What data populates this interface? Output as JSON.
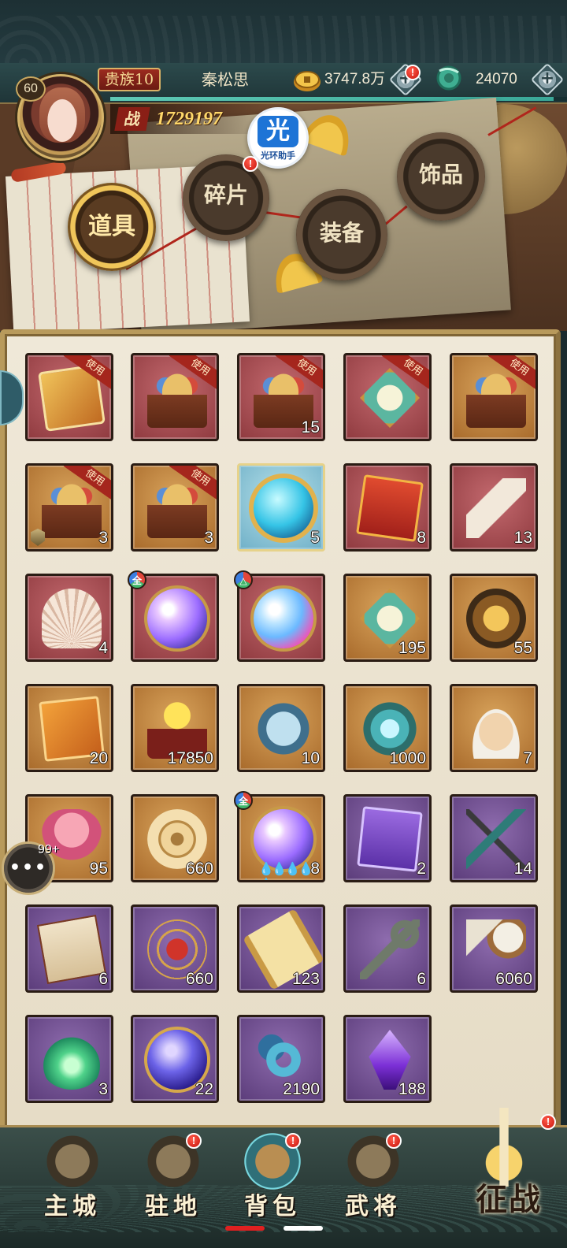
{
  "header": {
    "level": "60",
    "vip": "贵族10",
    "player_name": "秦松思",
    "gold": "3747.8万",
    "jade": "24070",
    "xp_fraction": 0.97,
    "power_icon": "战",
    "power_value": "1729197",
    "helper_icon": "光",
    "helper_label": "光环助手"
  },
  "tabs": [
    {
      "label": "道具",
      "active": true
    },
    {
      "label": "碎片",
      "badge": "!"
    },
    {
      "label": "装备"
    },
    {
      "label": "饰品"
    }
  ],
  "use_label": "使用",
  "items": [
    {
      "art": "a-card",
      "rarity": "r-red",
      "use": true,
      "count": "",
      "name": "golden-card-icon"
    },
    {
      "art": "a-chest",
      "rarity": "r-red",
      "use": true,
      "count": "",
      "name": "treasure-chest-icon"
    },
    {
      "art": "a-chest",
      "rarity": "r-red",
      "use": true,
      "count": "15",
      "name": "hero-chest-icon"
    },
    {
      "art": "a-medal",
      "rarity": "r-red",
      "use": true,
      "count": "",
      "name": "amulet-icon"
    },
    {
      "art": "a-chest",
      "rarity": "r-gold",
      "use": true,
      "count": "",
      "name": "gold-chest-icon"
    },
    {
      "art": "a-chest",
      "rarity": "r-gold",
      "use": true,
      "count": "3",
      "tag": true,
      "name": "crystal-chest-icon"
    },
    {
      "art": "a-chest",
      "rarity": "r-gold",
      "use": true,
      "count": "3",
      "name": "food-chest-icon"
    },
    {
      "art": "a-blue-orb",
      "rarity": "r-blue",
      "use": false,
      "count": "5",
      "name": "blue-orb-icon"
    },
    {
      "art": "a-redbook",
      "rarity": "r-red",
      "use": false,
      "count": "8",
      "name": "dragon-token-icon"
    },
    {
      "art": "a-horn",
      "rarity": "r-red",
      "use": false,
      "count": "13",
      "name": "horn-icon"
    },
    {
      "art": "a-shell",
      "rarity": "r-red",
      "use": false,
      "count": "4",
      "name": "shell-icon"
    },
    {
      "art": "a-orb",
      "rarity": "r-red",
      "use": false,
      "count": "",
      "badge": "全",
      "name": "spirit-orb-icon"
    },
    {
      "art": "a-orb2",
      "rarity": "r-red",
      "use": false,
      "count": "",
      "badge": "△",
      "name": "spirit-orb-2-icon"
    },
    {
      "art": "a-medal",
      "rarity": "r-gold",
      "use": false,
      "count": "195",
      "name": "sword-medal-icon"
    },
    {
      "art": "a-helm",
      "rarity": "r-gold",
      "use": false,
      "count": "55",
      "name": "helmet-medal-icon"
    },
    {
      "art": "a-ticket",
      "rarity": "r-gold",
      "use": false,
      "count": "20",
      "name": "ticket-icon"
    },
    {
      "art": "a-sphere",
      "rarity": "r-gold",
      "use": false,
      "count": "17850",
      "name": "golden-sphere-icon"
    },
    {
      "art": "a-fish",
      "rarity": "r-gold",
      "use": false,
      "count": "10",
      "name": "fish-icon"
    },
    {
      "art": "a-jade",
      "rarity": "r-gold",
      "use": false,
      "count": "1000",
      "name": "jade-disc-icon"
    },
    {
      "art": "a-dough",
      "rarity": "r-gold",
      "use": false,
      "count": "7",
      "name": "dough-icon"
    },
    {
      "art": "a-lion",
      "rarity": "r-gold",
      "use": false,
      "count": "95",
      "name": "lion-figure-icon"
    },
    {
      "art": "a-coin",
      "rarity": "r-gold",
      "use": false,
      "count": "660",
      "name": "coin-icon"
    },
    {
      "art": "a-orb",
      "rarity": "r-gold",
      "use": false,
      "count": "8",
      "badge": "全",
      "drops": "💧💧💧💧💧",
      "name": "spirit-orb-3-icon"
    },
    {
      "art": "a-purplecard",
      "rarity": "r-purple",
      "use": false,
      "count": "2",
      "name": "purple-card-icon"
    },
    {
      "art": "a-blade",
      "rarity": "r-purple",
      "use": false,
      "count": "14",
      "name": "blade-icon"
    },
    {
      "art": "a-map",
      "rarity": "r-purple",
      "use": false,
      "count": "6",
      "name": "map-icon"
    },
    {
      "art": "a-astro",
      "rarity": "r-purple",
      "use": false,
      "count": "660",
      "name": "astrolabe-icon"
    },
    {
      "art": "a-scroll",
      "rarity": "r-purple",
      "use": false,
      "count": "123",
      "name": "scroll-icon"
    },
    {
      "art": "a-key",
      "rarity": "r-purple",
      "use": false,
      "count": "6",
      "name": "key-icon"
    },
    {
      "art": "a-dagger",
      "rarity": "r-purple",
      "use": false,
      "count": "6060",
      "name": "dagger-icon"
    },
    {
      "art": "a-flame",
      "rarity": "r-purple",
      "use": false,
      "count": "3",
      "name": "green-flame-icon"
    },
    {
      "art": "a-blueorb2",
      "rarity": "r-purple",
      "use": false,
      "count": "22",
      "name": "purple-orb-icon"
    },
    {
      "art": "a-knot",
      "rarity": "r-purple",
      "use": false,
      "count": "2190",
      "name": "knot-icon"
    },
    {
      "art": "a-crystal",
      "rarity": "r-purple",
      "use": false,
      "count": "188",
      "name": "crystal-icon"
    }
  ],
  "chat": {
    "icon": "•••",
    "count": "99+"
  },
  "nav": [
    {
      "label": "主城",
      "badge": false
    },
    {
      "label": "驻地",
      "badge": true
    },
    {
      "label": "背包",
      "badge": true,
      "active": true
    },
    {
      "label": "武将",
      "badge": true
    }
  ],
  "battle": {
    "label": "征战",
    "badge": true
  },
  "colors": {
    "accent_gold": "#d9b266",
    "badge_red": "#c8150c",
    "panel_bg": "#efe8d8"
  }
}
